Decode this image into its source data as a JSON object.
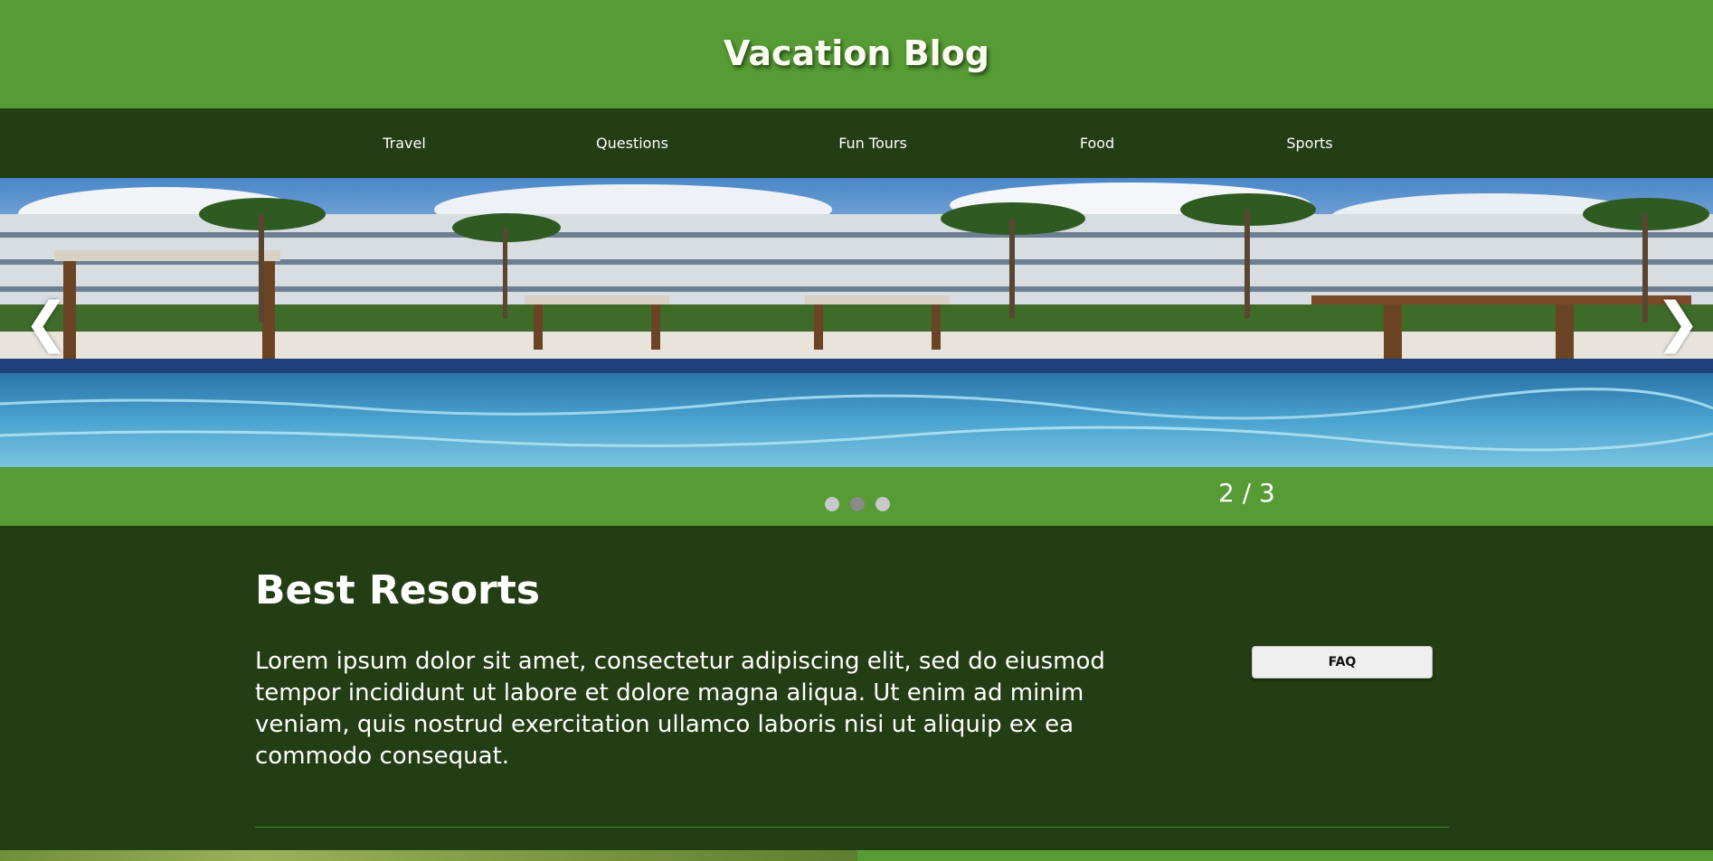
{
  "header": {
    "title": "Vacation Blog"
  },
  "nav": {
    "items": [
      {
        "label": "Travel"
      },
      {
        "label": "Questions"
      },
      {
        "label": "Fun Tours"
      },
      {
        "label": "Food"
      },
      {
        "label": "Sports"
      }
    ]
  },
  "slideshow": {
    "prev_arrow": "❮",
    "next_arrow": "❯",
    "counter": "2 / 3",
    "dot_count": 3,
    "active_dot": 2
  },
  "main": {
    "title": "Best Resorts",
    "text": "Lorem ipsum dolor sit amet, consectetur adipiscing elit, sed do eiusmod tempor incididunt ut labore et dolore magna aliqua. Ut enim ad minim veniam, quis nostrud exercitation ullamco laboris nisi ut aliquip ex ea commodo consequat.",
    "faq_label": "FAQ"
  },
  "colors": {
    "header_green": "#569b34",
    "dark_green": "#233d14",
    "dot_inactive": "#c8c8c8",
    "dot_active": "#8a8a8a"
  }
}
